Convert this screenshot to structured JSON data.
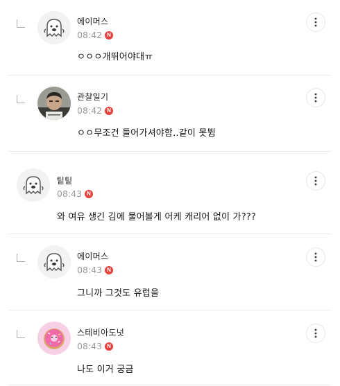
{
  "comments": [
    {
      "name": "에이머스",
      "time": "08:42",
      "badge": "N",
      "text": "ㅇㅇㅇ개뛰어야대ㅠ",
      "is_reply": true,
      "avatar": "ghost-avatar-icon"
    },
    {
      "name": "관찰일기",
      "time": "08:42",
      "badge": "N",
      "text": "ㅇㅇ무조건 들어가셔야함..같이 못뜀",
      "is_reply": true,
      "avatar": "person-photo-avatar"
    },
    {
      "name": "팉팉",
      "time": "08:43",
      "badge": "N",
      "text": "와 여유 생긴 김에 물어볼게 어케 캐리어 없이 가???",
      "is_reply": false,
      "avatar": "ghost-avatar-icon"
    },
    {
      "name": "에이머스",
      "time": "08:43",
      "badge": "N",
      "text": "그니까 그것도 유럽을",
      "is_reply": true,
      "avatar": "ghost-avatar-icon"
    },
    {
      "name": "스테비아도넛",
      "time": "08:43",
      "badge": "N",
      "text": "나도 이거 궁금",
      "is_reply": true,
      "avatar": "donut-avatar-icon"
    }
  ],
  "colors": {
    "badge": "#e8413c",
    "divider": "#ececec",
    "time": "#9a9a9a"
  },
  "icons": {
    "more": "more-vertical-icon",
    "reply": "reply-corner-icon"
  }
}
